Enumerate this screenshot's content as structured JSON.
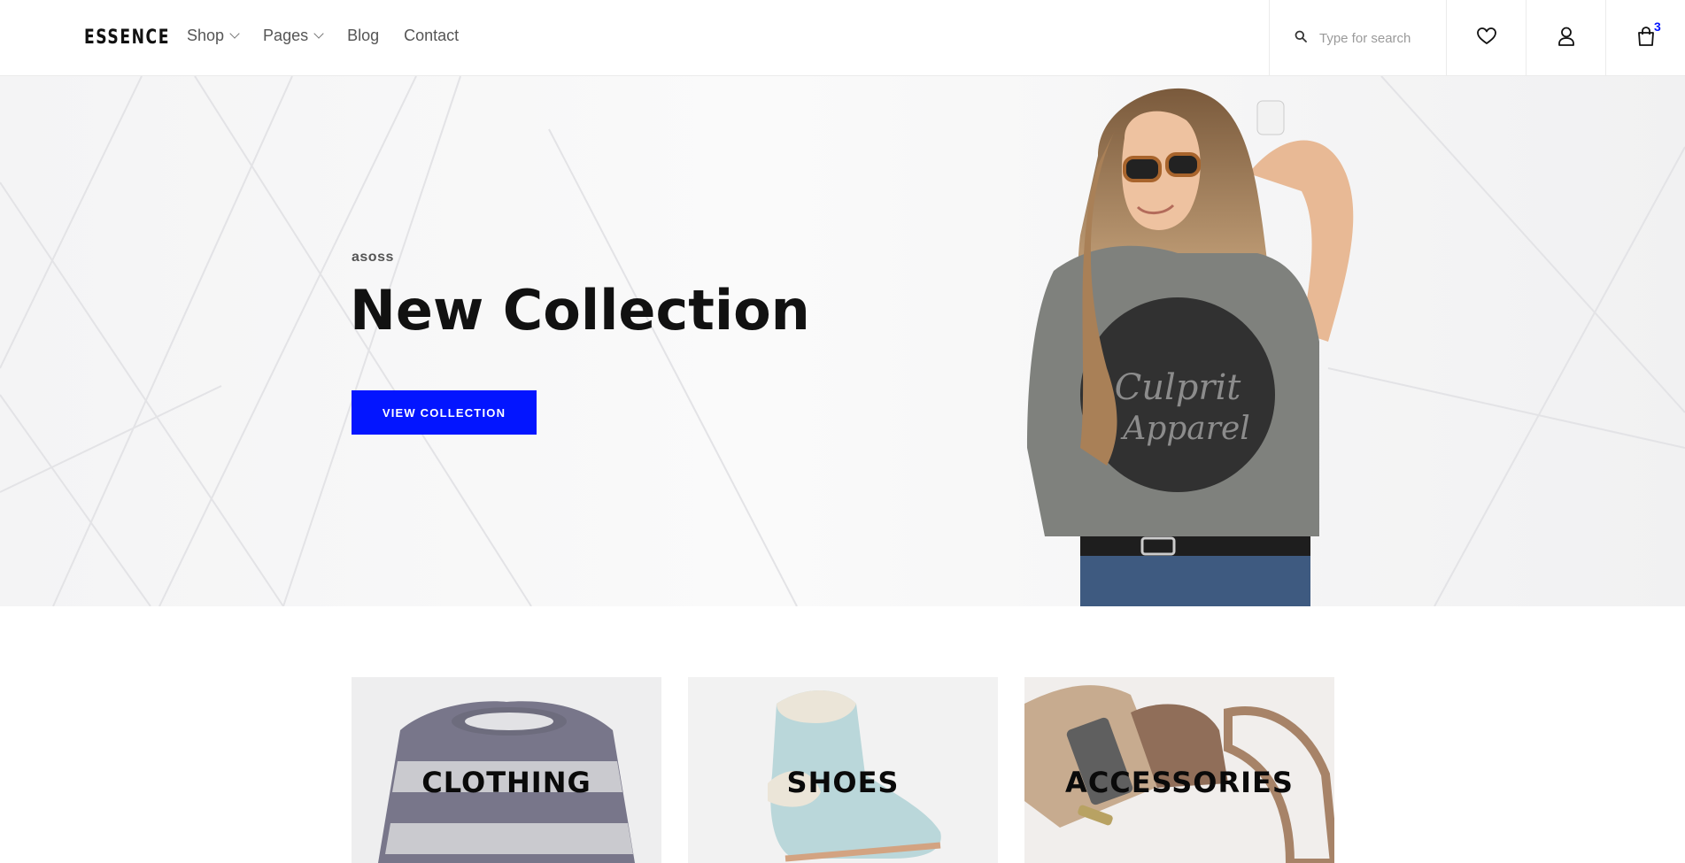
{
  "header": {
    "logo": "ESSENCE",
    "nav": [
      {
        "label": "Shop",
        "has_dropdown": true
      },
      {
        "label": "Pages",
        "has_dropdown": true
      },
      {
        "label": "Blog",
        "has_dropdown": false
      },
      {
        "label": "Contact",
        "has_dropdown": false
      }
    ],
    "search": {
      "placeholder": "Type for search",
      "value": "",
      "icon": "search-icon"
    },
    "actions": {
      "wishlist_icon": "heart-icon",
      "account_icon": "user-icon",
      "cart_icon": "shopping-bag-icon",
      "cart_count": "3"
    }
  },
  "hero": {
    "brand": "asoss",
    "title": "New Collection",
    "button_label": "VIEW COLLECTION"
  },
  "categories": [
    {
      "label": "CLOTHING"
    },
    {
      "label": "SHOES"
    },
    {
      "label": "ACCESSORIES"
    }
  ],
  "colors": {
    "accent": "#0315ff",
    "text_dark": "#111111",
    "nav_text": "#555555",
    "border": "#ebebeb"
  }
}
